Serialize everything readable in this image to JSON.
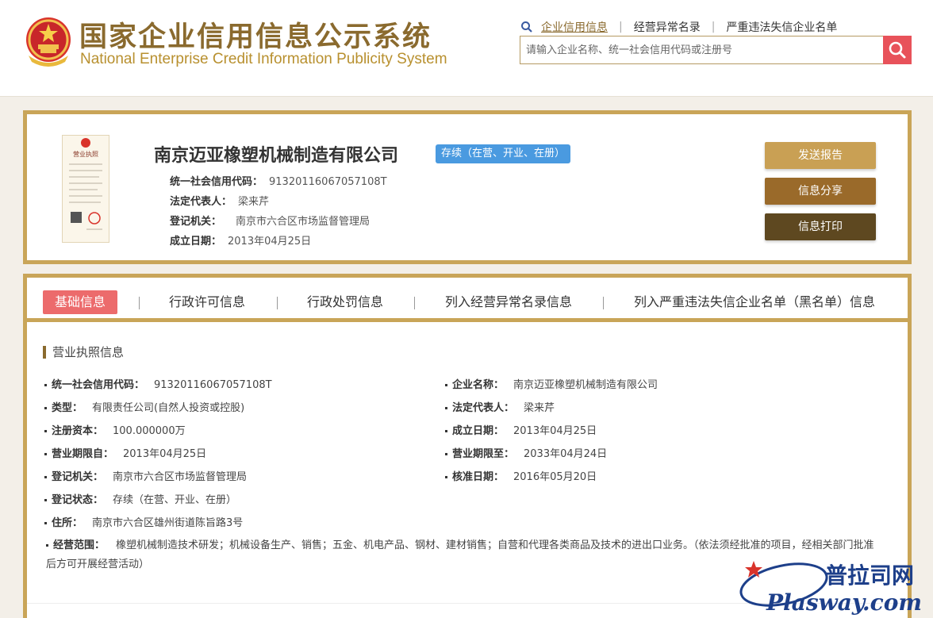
{
  "header": {
    "title_cn": "国家企业信用信息公示系统",
    "title_en": "National Enterprise Credit Information Publicity System",
    "links": [
      "企业信用信息",
      "经营异常名录",
      "严重违法失信企业名单"
    ],
    "search_placeholder": "请输入企业名称、统一社会信用代码或注册号"
  },
  "company": {
    "name": "南京迈亚橡塑机械制造有限公司",
    "status": "存续（在营、开业、在册）",
    "credit_code_label": "统一社会信用代码：",
    "credit_code": "91320116067057108T",
    "legal_rep_label": "法定代表人：",
    "legal_rep": "梁来芹",
    "reg_authority_label": "登记机关：",
    "reg_authority": "南京市六合区市场监督管理局",
    "founded_label": "成立日期：",
    "founded": "2013年04月25日",
    "license_caption": "营业执照"
  },
  "actions": {
    "send_report": "发送报告",
    "share": "信息分享",
    "print": "信息打印"
  },
  "tabs": [
    "基础信息",
    "行政许可信息",
    "行政处罚信息",
    "列入经营异常名录信息",
    "列入严重违法失信企业名单（黑名单）信息"
  ],
  "license_info": {
    "section_title": "营业执照信息",
    "left": [
      {
        "label": "统一社会信用代码：",
        "value": "91320116067057108T"
      },
      {
        "label": "类型：",
        "value": "有限责任公司(自然人投资或控股)"
      },
      {
        "label": "注册资本：",
        "value": "100.000000万"
      },
      {
        "label": "营业期限自：",
        "value": "2013年04月25日"
      },
      {
        "label": "登记机关：",
        "value": "南京市六合区市场监督管理局"
      },
      {
        "label": "登记状态：",
        "value": "存续（在营、开业、在册）"
      },
      {
        "label": "住所：",
        "value": "南京市六合区雄州街道陈旨路3号"
      }
    ],
    "right": [
      {
        "label": "企业名称：",
        "value": "南京迈亚橡塑机械制造有限公司"
      },
      {
        "label": "法定代表人：",
        "value": "梁来芹"
      },
      {
        "label": "成立日期：",
        "value": "2013年04月25日"
      },
      {
        "label": "营业期限至：",
        "value": "2033年04月24日"
      },
      {
        "label": "核准日期：",
        "value": "2016年05月20日"
      }
    ],
    "scope_label": "经营范围：",
    "scope": "橡塑机械制造技术研发；机械设备生产、销售；五金、机电产品、钢材、建材销售；自营和代理各类商品及技术的进出口业务。（依法须经批准的项目，经相关部门批准后方可开展经营活动）"
  },
  "watermark": {
    "text_cn": "普拉司网",
    "text_en": "Plasway.com"
  }
}
